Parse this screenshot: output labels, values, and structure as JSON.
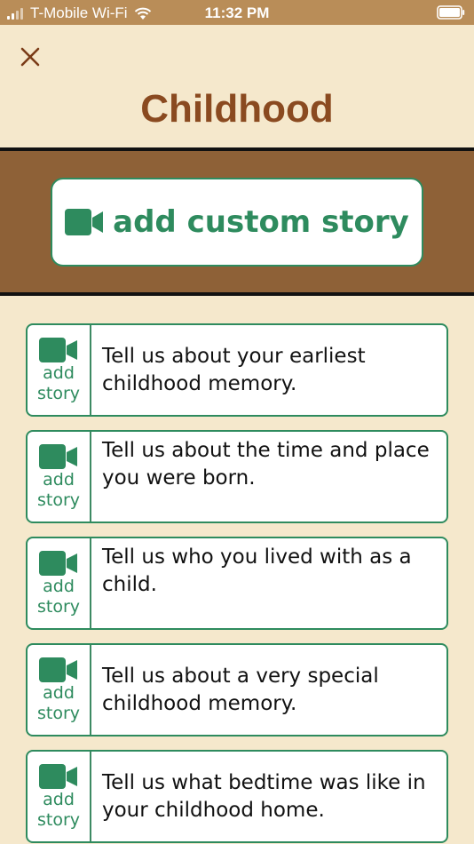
{
  "status_bar": {
    "carrier": "T-Mobile Wi-Fi",
    "time": "11:32 PM",
    "icons": [
      "signal-icon",
      "wifi-icon",
      "battery-icon"
    ]
  },
  "header": {
    "close_icon": "close-icon",
    "title": "Childhood"
  },
  "custom_story": {
    "label": "add custom story",
    "icon": "video-camera-icon"
  },
  "stories": [
    {
      "add_line1": "add",
      "add_line2": "story",
      "prompt": "Tell us about your earliest childhood memory."
    },
    {
      "add_line1": "add",
      "add_line2": "story",
      "prompt": "Tell us about the time and place you were born."
    },
    {
      "add_line1": "add",
      "add_line2": "story",
      "prompt": "Tell us who you lived with as a child."
    },
    {
      "add_line1": "add",
      "add_line2": "story",
      "prompt": "Tell us about a very special childhood memory."
    },
    {
      "add_line1": "add",
      "add_line2": "story",
      "prompt": "Tell us what bedtime was like in your childhood home."
    }
  ],
  "colors": {
    "background": "#f5e8cc",
    "status_bar": "#b98d58",
    "title": "#8a4a20",
    "banner": "#8e6137",
    "accent_green": "#2e8b5e"
  }
}
